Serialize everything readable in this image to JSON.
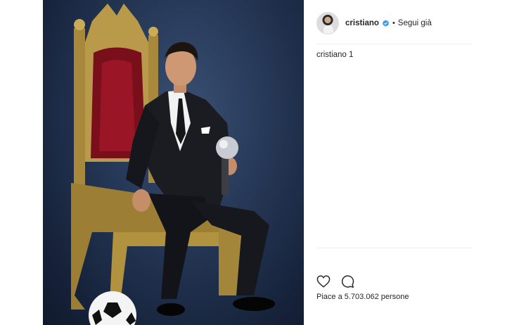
{
  "post": {
    "username": "cristiano",
    "verified_icon": "verified-badge-icon",
    "separator": "•",
    "follow_label": "Segui già",
    "caption_user": "cristiano",
    "caption_text": "1",
    "likes_text": "Piace a 5.703.062 persone"
  },
  "icons": {
    "like": "heart-icon",
    "comment": "comment-icon"
  },
  "colors": {
    "verified_blue": "#3897f0",
    "text": "#262626",
    "divider": "#efefef"
  }
}
